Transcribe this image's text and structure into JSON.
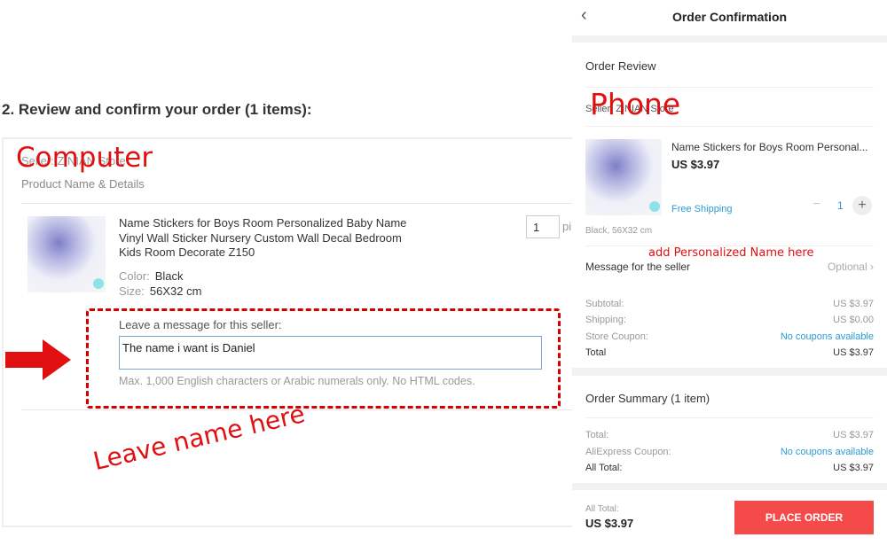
{
  "computer": {
    "title": "2. Review and confirm your order (1 items):",
    "seller": "Seller: ZINIAN Store",
    "product_header": "Product Name & Details",
    "product_name": "Name Stickers for Boys Room Personalized Baby Name Vinyl Wall Sticker Nursery Custom Wall Decal Bedroom Kids Room Decorate Z150",
    "color_label": "Color:",
    "color_value": "Black",
    "size_label": "Size:",
    "size_value": "56X32 cm",
    "quantity": "1",
    "unit": "pi",
    "message_label": "Leave a message for this seller:",
    "message_value": "The name i want is Daniel",
    "message_hint": "Max. 1,000 English characters or Arabic numerals only. No HTML codes."
  },
  "annotations": {
    "computer": "Computer",
    "phone": "Phone",
    "leave_name": "Leave name here",
    "add_name": "add Personalized Name here",
    "accent": "#e01010"
  },
  "phone": {
    "header_title": "Order Confirmation",
    "order_review": "Order Review",
    "seller": "Seller: ZINIAN Store",
    "product_name": "Name Stickers for Boys Room Personal...",
    "price": "US $3.97",
    "shipping": "Free Shipping",
    "quantity": "1",
    "variant": "Black, 56X32 cm",
    "message_label": "Message for the seller",
    "message_placeholder": "Optional",
    "subtotal_label": "Subtotal:",
    "subtotal": "US $3.97",
    "shipping_label": "Shipping:",
    "shipping_cost": "US $0.00",
    "store_coupon_label": "Store Coupon:",
    "store_coupon": "No coupons available",
    "total_label": "Total",
    "total": "US $3.97",
    "summary_title": "Order Summary (1 item)",
    "sum_total_label": "Total:",
    "sum_total": "US $3.97",
    "ae_coupon_label": "AliExpress Coupon:",
    "ae_coupon": "No coupons available",
    "all_total_label": "All Total:",
    "all_total": "US $3.97",
    "footer_all_total_label": "All Total:",
    "footer_all_total": "US $3.97",
    "place_order": "PLACE ORDER",
    "brand_color": "#f44a4a"
  }
}
